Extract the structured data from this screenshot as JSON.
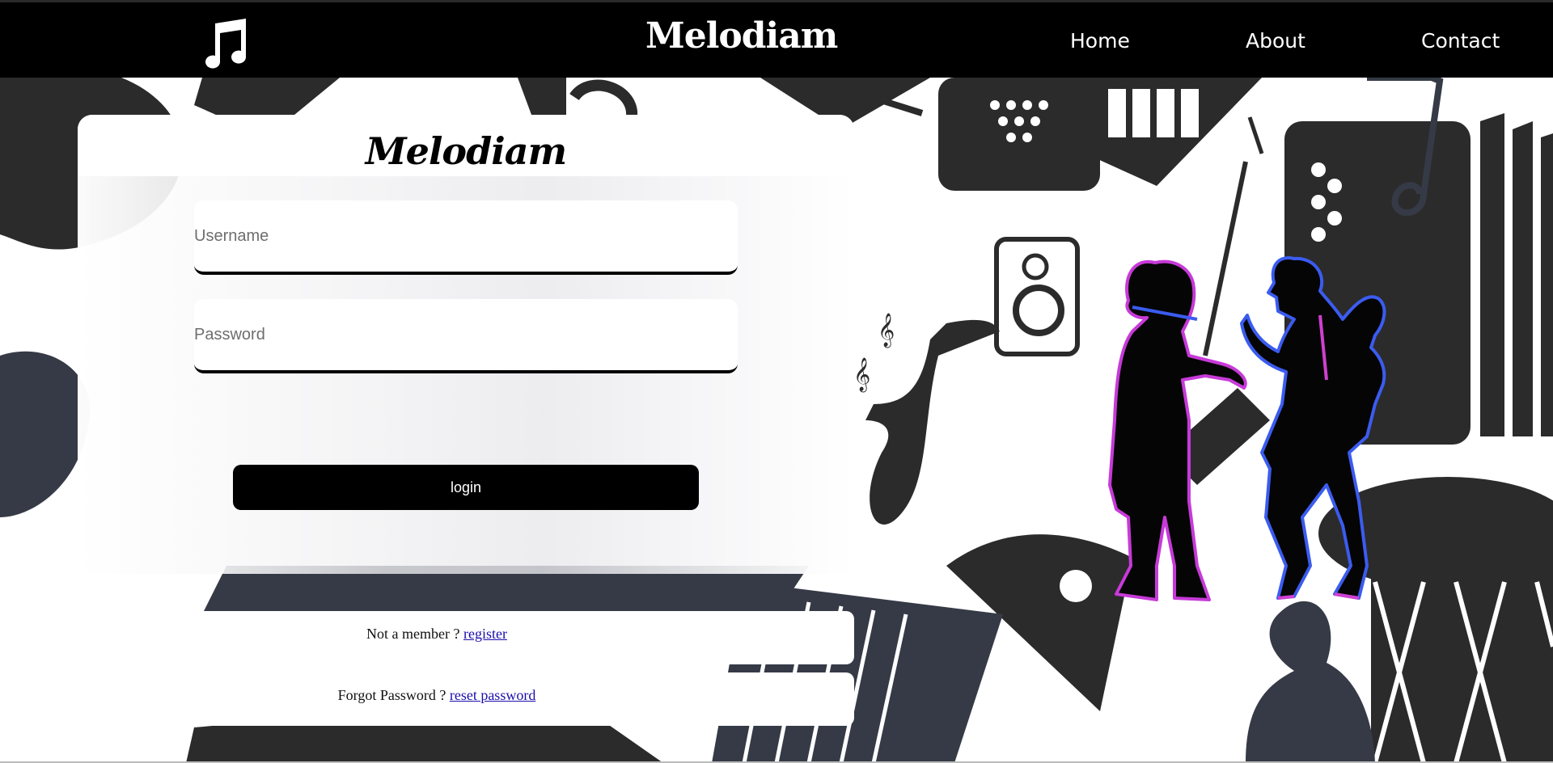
{
  "navbar": {
    "brand": "Melodiam",
    "logo_icon": "music-note-icon",
    "links": {
      "home": "Home",
      "about": "About",
      "contact": "Contact"
    }
  },
  "login": {
    "title": "Melodiam",
    "username_placeholder": "Username",
    "password_placeholder": "Password",
    "button_label": "login"
  },
  "footer_links": {
    "register_prefix": "Not a member ? ",
    "register_link": "register",
    "reset_prefix": "Forgot Password ? ",
    "reset_link": "reset password"
  },
  "colors": {
    "navbar_bg": "#000000",
    "art_dark": "#2b2b2b",
    "art_slate": "#353a46",
    "neon_pink": "#e03ad8",
    "neon_blue": "#4a6cf5",
    "link": "#1a0dab"
  }
}
